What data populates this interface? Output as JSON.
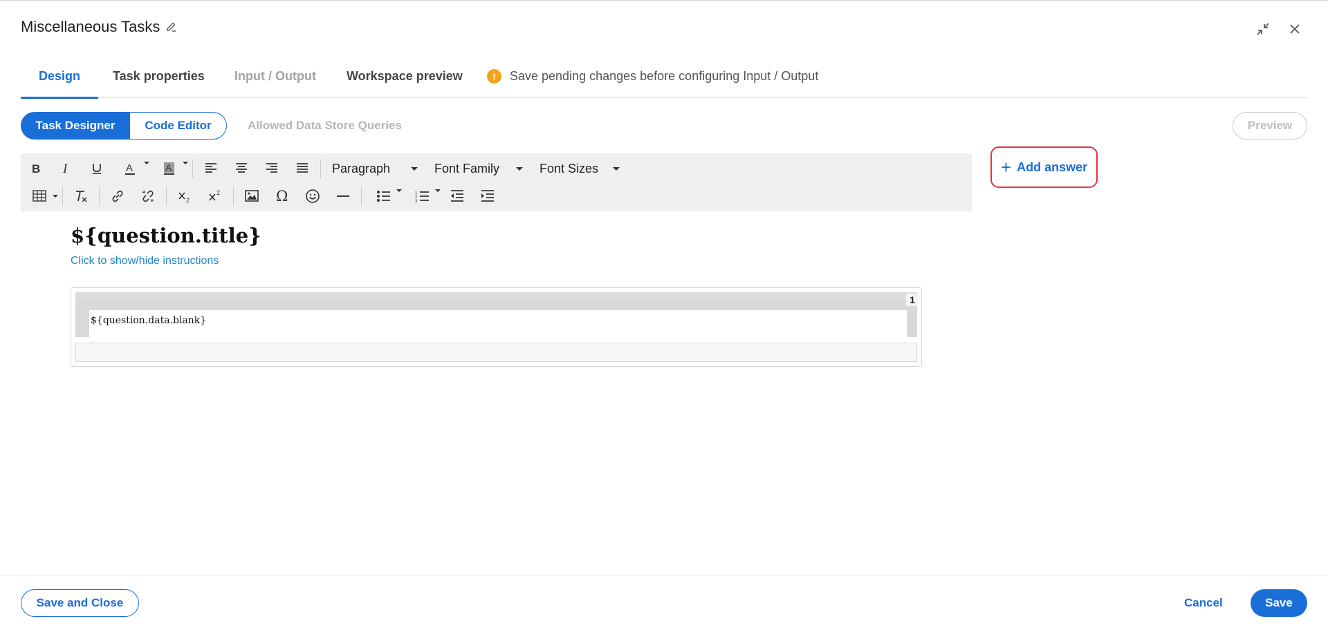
{
  "header": {
    "title": "Miscellaneous Tasks",
    "edit_icon": "pencil-icon",
    "collapse_icon": "collapse-icon",
    "close_icon": "close-icon"
  },
  "tabs": [
    {
      "label": "Design",
      "state": "active"
    },
    {
      "label": "Task properties",
      "state": "normal"
    },
    {
      "label": "Input / Output",
      "state": "disabled"
    },
    {
      "label": "Workspace preview",
      "state": "normal"
    }
  ],
  "warning": {
    "icon": "!",
    "text": "Save pending changes before configuring Input / Output"
  },
  "mode": {
    "task_designer": "Task Designer",
    "code_editor": "Code Editor",
    "allowed_queries": "Allowed Data Store Queries"
  },
  "preview_label": "Preview",
  "toolbar": {
    "paragraph": "Paragraph",
    "font_family": "Font Family",
    "font_sizes": "Font Sizes",
    "buttons_row1": [
      "bold-icon",
      "italic-icon",
      "underline-icon",
      "text-color-icon",
      "background-color-icon",
      "align-left-icon",
      "align-center-icon",
      "align-right-icon",
      "justify-icon"
    ],
    "buttons_row2": [
      "table-icon",
      "clear-format-icon",
      "link-icon",
      "unlink-icon",
      "subscript-icon",
      "superscript-icon",
      "image-icon",
      "special-char-icon",
      "emoji-icon",
      "horizontal-rule-icon",
      "bullet-list-icon",
      "numbered-list-icon",
      "outdent-icon",
      "indent-icon"
    ]
  },
  "add_answer": {
    "icon": "+",
    "label": "Add answer"
  },
  "content": {
    "question_title": "${question.title}",
    "instructions_link": "Click to show/hide instructions",
    "answer_field": "${question.data.blank}",
    "answer_number": "1"
  },
  "footer": {
    "save_and_close": "Save and Close",
    "cancel": "Cancel",
    "save": "Save"
  },
  "colors": {
    "accent": "#1a6ed8",
    "warning": "#f2a41b",
    "highlight": "#e0353f"
  }
}
